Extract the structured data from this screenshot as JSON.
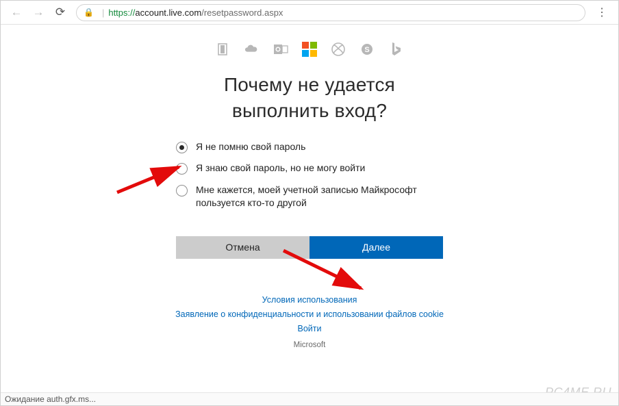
{
  "url": {
    "protocol": "https",
    "host": "account.live.com",
    "path": "/resetpassword.aspx"
  },
  "title_line1": "Почему не удается",
  "title_line2": "выполнить вход?",
  "options": [
    {
      "label": "Я не помню свой пароль",
      "checked": true
    },
    {
      "label": "Я знаю свой пароль, но не могу войти",
      "checked": false
    },
    {
      "label": "Мне кажется, моей учетной записью Майкрософт пользуется кто-то другой",
      "checked": false
    }
  ],
  "buttons": {
    "cancel": "Отмена",
    "next": "Далее"
  },
  "footer": {
    "terms": "Условия использования",
    "privacy": "Заявление о конфиденциальности и использовании файлов cookie",
    "signin": "Войти",
    "brand": "Microsoft"
  },
  "status_text": "Ожидание auth.gfx.ms...",
  "watermark": "PC4ME.RU",
  "icons": {
    "office": "office-icon",
    "onedrive": "onedrive-icon",
    "outlook": "outlook-icon",
    "microsoft": "microsoft-icon",
    "xbox": "xbox-icon",
    "skype": "skype-icon",
    "bing": "bing-icon"
  }
}
